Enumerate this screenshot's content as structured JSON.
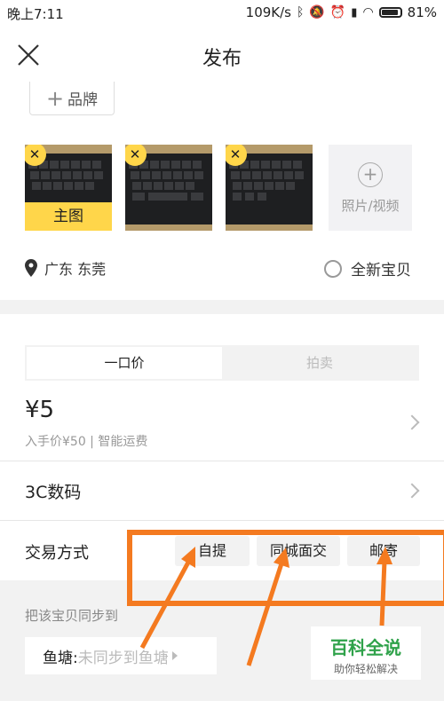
{
  "status_bar": {
    "time": "晚上7:11",
    "network_speed": "109K/s",
    "battery_percent": "81%"
  },
  "header": {
    "title": "发布"
  },
  "brand": {
    "label": "品牌"
  },
  "photos": {
    "main_label": "主图",
    "add_label": "照片/视频",
    "delete_glyph": "✕"
  },
  "location": {
    "text": "广东 东莞"
  },
  "new_item": {
    "label": "全新宝贝"
  },
  "pricing_tabs": [
    {
      "label": "一口价",
      "active": true
    },
    {
      "label": "拍卖",
      "active": false
    }
  ],
  "price": {
    "value": "¥5",
    "info": "入手价¥50 | 智能运费"
  },
  "category": {
    "label": "3C数码"
  },
  "trade": {
    "label": "交易方式",
    "options": [
      "自提",
      "同城面交",
      "邮寄"
    ]
  },
  "sync": {
    "label": "把该宝贝同步到",
    "pond_key": "鱼塘:",
    "pond_value": "未同步到鱼塘"
  },
  "watermark": {
    "title": "百科全说",
    "subtitle": "助你轻松解决"
  },
  "colors": {
    "accent_yellow": "#ffd64a",
    "annotation_orange": "#f47a20",
    "watermark_green": "#2fa24a"
  },
  "icons": [
    "close-icon",
    "plus-icon",
    "location-pin-icon",
    "radio-icon",
    "chevron-right-icon",
    "bluetooth-icon",
    "wifi-icon",
    "battery-icon"
  ]
}
